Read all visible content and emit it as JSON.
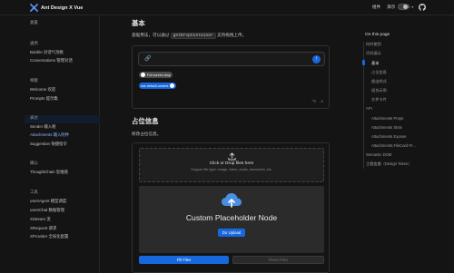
{
  "header": {
    "title": "Ant Design X Vue",
    "nav": [
      "组件",
      "演示",
      "更多"
    ]
  },
  "sidebar": {
    "overview": "总览",
    "groups": [
      {
        "title": "通用",
        "items": [
          "Bubble 对话气泡框",
          "Conversations 管理对话"
        ]
      },
      {
        "title": "唤醒",
        "items": [
          "Welcome 欢迎",
          "Prompts 提示集"
        ]
      },
      {
        "title": "表达",
        "items": [
          "Sender 输入框",
          "Attachments 输入附件",
          "Suggestion 快捷指令"
        ]
      },
      {
        "title": "确认",
        "items": [
          "ThoughtChain 思维链"
        ]
      },
      {
        "title": "工具",
        "items": [
          "useXAgent 模型调度",
          "useXChat 数据管理",
          "XStream 流",
          "XRequest 请求",
          "XProvider 全局化配置"
        ]
      }
    ],
    "active": "Attachments 输入附件"
  },
  "main": {
    "section1": {
      "heading": "基本",
      "desc_before": "基础用法，可以通过",
      "desc_code": "getDropContainer",
      "desc_after": "支持拖拽上传。",
      "switch_fullscreen": "Full screen drop",
      "switch_default": "use default content"
    },
    "section2": {
      "heading": "占位信息",
      "desc": "修改占位信息。",
      "drop_title": "Click or Drop files here",
      "drop_subtitle": "Support file type: image, video, audio, document, etc.",
      "placeholder_title": "Custom Placeholder Node",
      "upload_button": "Do Upload",
      "fill_button": "Fill Files",
      "reset_button": "Reset Files"
    }
  },
  "toc": {
    "title": "On this page",
    "items": [
      "何时使用",
      "代码演示",
      "基本",
      "占位信息",
      "超出样式",
      "组合示例",
      "文件卡片",
      "API",
      "Attachments Props",
      "Attachments Slots",
      "Attachments Expose",
      "Attachments.FileCard Pr...",
      "Semantic DOM",
      "主题变量（Design Token）"
    ],
    "active": "基本"
  },
  "colors": {
    "background": "#141414",
    "primary": "#1668dc",
    "active_link": "#8fb6ff"
  }
}
